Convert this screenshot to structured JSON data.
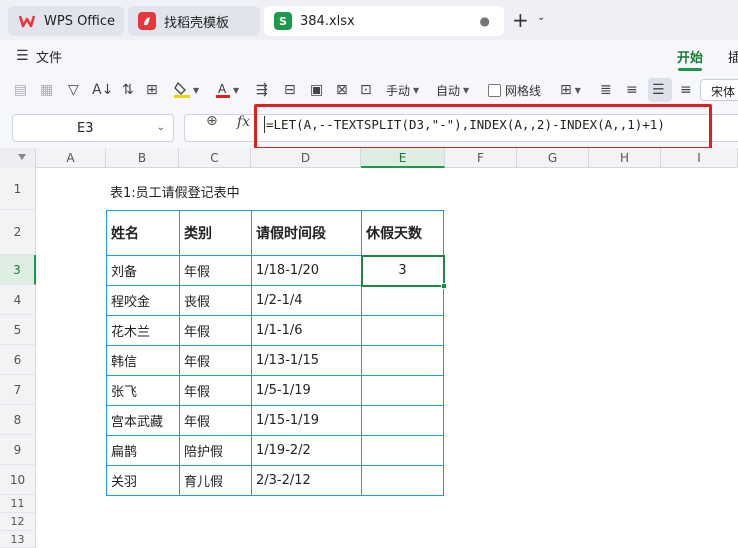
{
  "tabs": [
    {
      "label": "WPS Office",
      "icon": "wps-logo-icon"
    },
    {
      "label": "找稻壳模板",
      "icon": "docer-logo-icon"
    },
    {
      "label": "384.xlsx",
      "icon": "spreadsheet-icon",
      "logo_text": "S"
    }
  ],
  "menu": {
    "file_label": "文件",
    "ribbon_tabs": [
      "开始",
      "插"
    ]
  },
  "toolbar": {
    "manual_label": "手动",
    "auto_label": "自动",
    "gridlines_label": "网格线",
    "font_value": "宋体"
  },
  "formula_bar": {
    "cell_ref": "E3",
    "fx_symbol": "fx",
    "formula": "=LET(A,--TEXTSPLIT(D3,\"-\"),INDEX(A,,2)-INDEX(A,,1)+1)"
  },
  "grid": {
    "columns": [
      "A",
      "B",
      "C",
      "D",
      "E",
      "F",
      "G",
      "H",
      "I"
    ],
    "rows": [
      "1",
      "2",
      "3",
      "4",
      "5",
      "6",
      "7",
      "8",
      "9",
      "10",
      "11",
      "12",
      "13"
    ],
    "selected_col": "E",
    "selected_row": "3"
  },
  "sheet": {
    "title": "表1:员工请假登记表中",
    "headers": [
      "姓名",
      "类别",
      "请假时间段",
      "休假天数"
    ],
    "rows": [
      [
        "刘备",
        "年假",
        "1/18-1/20",
        "3"
      ],
      [
        "程咬金",
        "丧假",
        "1/2-1/4",
        ""
      ],
      [
        "花木兰",
        "年假",
        "1/1-1/6",
        ""
      ],
      [
        "韩信",
        "年假",
        "1/13-1/15",
        ""
      ],
      [
        "张飞",
        "年假",
        "1/5-1/19",
        ""
      ],
      [
        "宫本武藏",
        "年假",
        "1/15-1/19",
        ""
      ],
      [
        "扁鹊",
        "陪护假",
        "1/19-2/2",
        ""
      ],
      [
        "关羽",
        "育儿假",
        "2/3-2/12",
        ""
      ]
    ]
  },
  "colors": {
    "accent_green": "#1a9a4a",
    "table_border": "#19a0d8",
    "highlight_red": "#e02020",
    "wps_red": "#e8373a"
  }
}
